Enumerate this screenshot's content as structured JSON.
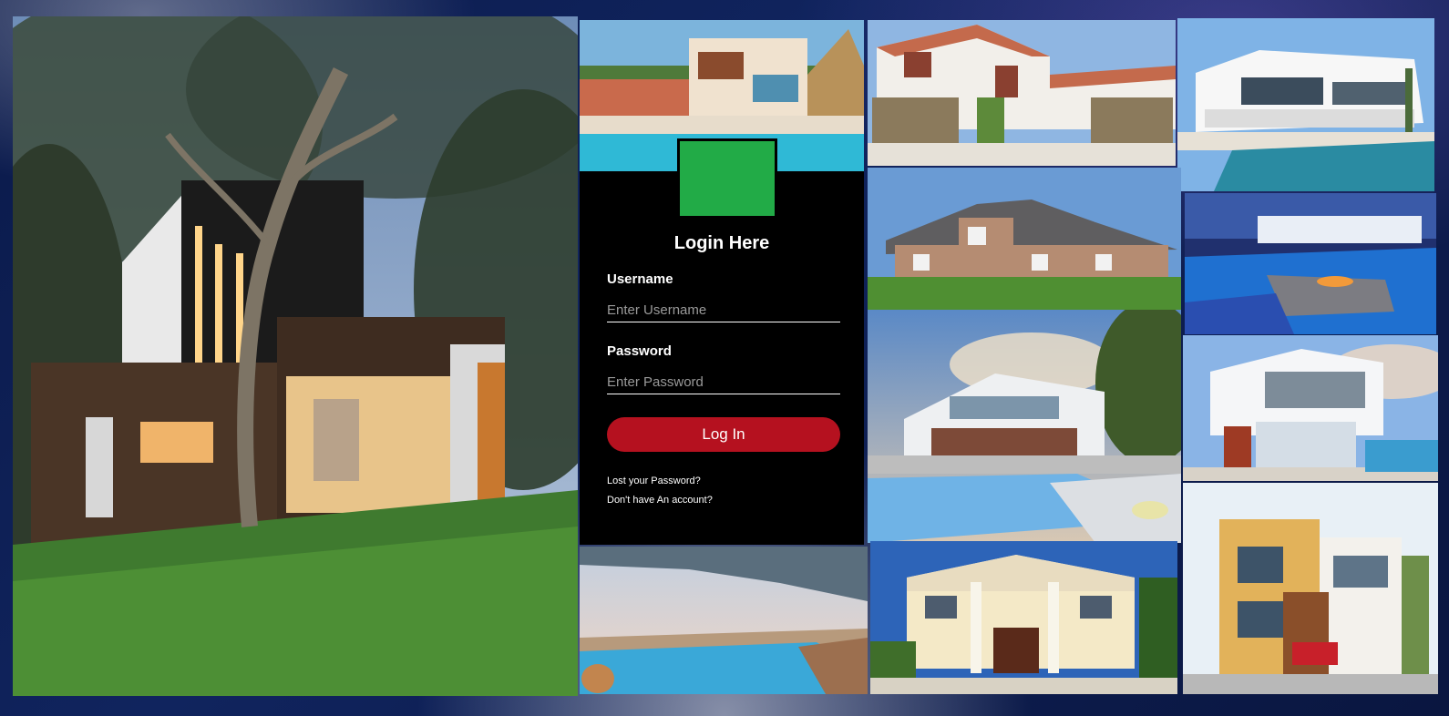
{
  "login": {
    "title": "Login Here",
    "username_label": "Username",
    "username_placeholder": "Enter Username",
    "password_label": "Password",
    "password_placeholder": "Enter Password",
    "button_label": "Log In",
    "lost_password_link": "Lost your Password?",
    "no_account_link": "Don't have An account?"
  },
  "colors": {
    "panel_bg": "#000000",
    "avatar": "#22ab47",
    "button": "#b5111f",
    "page_bg": "#10245e"
  },
  "gallery": {
    "tiles": [
      {
        "id": "main-modern-house-photo"
      },
      {
        "id": "pool-villa-photo"
      },
      {
        "id": "white-garage-house-photo"
      },
      {
        "id": "modern-pool-villa-photo"
      },
      {
        "id": "brick-suburban-house-photo"
      },
      {
        "id": "infinity-pool-firepit-photo"
      },
      {
        "id": "glass-modern-mansion-photo"
      },
      {
        "id": "white-cube-house-photo"
      },
      {
        "id": "overhang-pool-view-photo"
      },
      {
        "id": "columned-mansion-photo"
      },
      {
        "id": "orange-modern-townhouse-photo"
      }
    ]
  }
}
